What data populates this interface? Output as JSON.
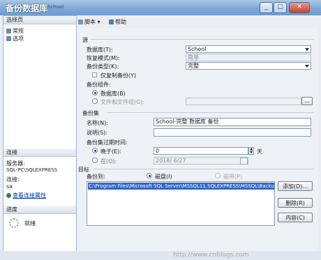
{
  "window": {
    "title": "备份数据库",
    "subtitle": "School"
  },
  "titlebar_buttons": {
    "minimize": "_",
    "maximize": "□",
    "close": "✕"
  },
  "sidebar": {
    "select_page_header": "选择页",
    "pages": [
      {
        "label": "常规"
      },
      {
        "label": "选项"
      }
    ],
    "connection_header": "连接",
    "server_label": "服务器:",
    "server_value": "SQL-PC\\SQLEXPRESS",
    "connect_label": "连接:",
    "connect_value": "sa",
    "view_link": "查看连接属性",
    "progress_header": "进度",
    "progress_status": "就绪"
  },
  "toolbar": {
    "script_label": "脚本",
    "help_label": "帮助"
  },
  "source": {
    "group_label": "源",
    "database_label": "数据库(T):",
    "database_value": "School",
    "recovery_label": "恢复模式(M):",
    "recovery_value": "简单",
    "backup_type_label": "备份类型(K):",
    "backup_type_value": "完整",
    "copy_only_label": "仅复制备份(Y)",
    "component_label": "备份组件:",
    "component_db": "数据库(B)",
    "component_file": "文件和文件组(G):"
  },
  "backup_set": {
    "group_label": "备份集",
    "name_label": "名称(N):",
    "name_value": "School-完整 数据库 备份",
    "desc_label": "说明(S):",
    "expire_label": "备份集过期时间:",
    "after_label": "晚于(E):",
    "after_value": "0",
    "after_unit": "天",
    "on_label": "在(O):",
    "on_value": "2018/ 6/27"
  },
  "destination": {
    "group_label": "目标",
    "backup_to_label": "备份到:",
    "disk_label": "磁盘(I)",
    "tape_label": "磁带(P)",
    "path_value": "C:\\Program Files\\Microsoft SQL Server\\MSSQL11.SQLEXPRESS\\MSSQL\\Backup\\School.bak",
    "add_button": "添加(D)...",
    "remove_button": "删除(R)",
    "contents_button": "内容(C)"
  },
  "watermark": "http://www.cnblogs.com"
}
